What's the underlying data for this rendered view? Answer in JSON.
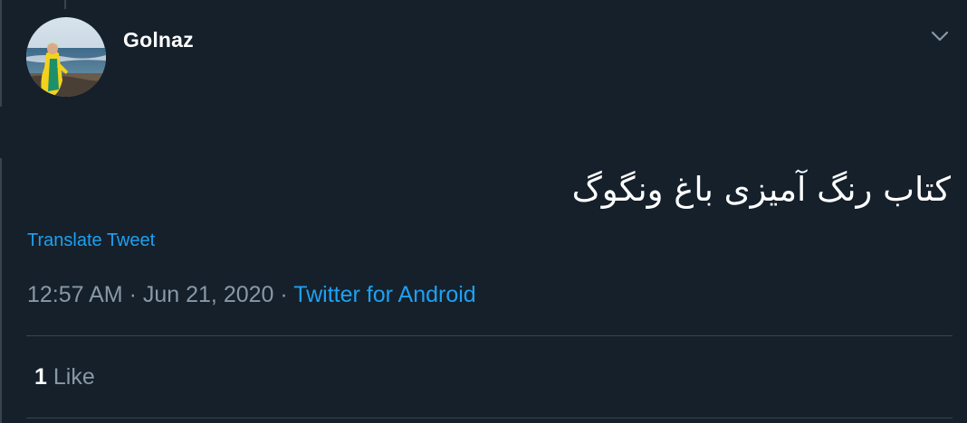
{
  "tweet": {
    "author": {
      "display_name": "Golnaz"
    },
    "text": "کتاب رنگ آمیزی باغ ونگوگ",
    "translate_label": "Translate Tweet",
    "time": "12:57 AM",
    "separator": "·",
    "date": "Jun 21, 2020",
    "source": "Twitter for Android",
    "likes": {
      "count": "1",
      "label": "Like"
    }
  },
  "icons": {
    "menu": "chevron-down-icon"
  },
  "colors": {
    "background": "#15202b",
    "text": "#ffffff",
    "secondary_text": "#8899a6",
    "accent": "#1da1f2",
    "divider": "#38444d"
  }
}
